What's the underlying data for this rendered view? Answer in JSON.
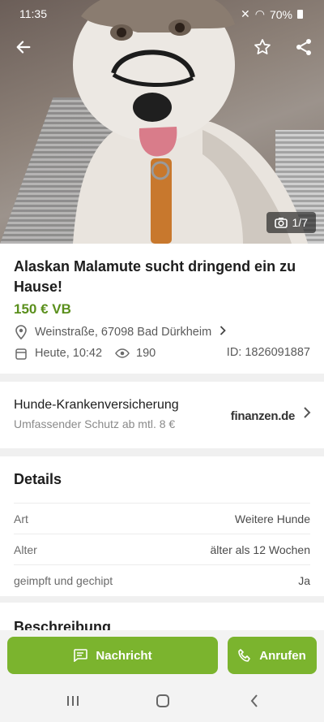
{
  "status_bar": {
    "time": "11:35",
    "battery": "70%"
  },
  "gallery": {
    "counter": "1/7"
  },
  "listing": {
    "title": "Alaskan Malamute sucht dringend ein zu Hause!",
    "price": "150 € VB",
    "location": "Weinstraße, 67098 Bad Dürkheim",
    "date": "Heute, 10:42",
    "views": "190",
    "id": "ID: 1826091887"
  },
  "insurance": {
    "title": "Hunde-Krankenversicherung",
    "subtitle": "Umfassender Schutz ab mtl. 8 €",
    "logo": "finanzen.de"
  },
  "details": {
    "title": "Details",
    "rows": [
      {
        "key": "Art",
        "value": "Weitere Hunde"
      },
      {
        "key": "Alter",
        "value": "älter als 12 Wochen"
      },
      {
        "key": "geimpft und gechipt",
        "value": "Ja"
      }
    ]
  },
  "description": {
    "title": "Beschreibung"
  },
  "actions": {
    "message_label": "Nachricht",
    "call_label": "Anrufen"
  },
  "icons": {
    "back": "arrow-left-icon",
    "favorite": "star-icon",
    "share": "share-icon",
    "camera": "camera-icon",
    "location": "map-pin-icon",
    "calendar": "calendar-icon",
    "views": "eye-icon",
    "message": "message-icon",
    "phone": "phone-icon"
  },
  "colors": {
    "accent": "#7bb42e",
    "price": "#5a8f1c"
  }
}
